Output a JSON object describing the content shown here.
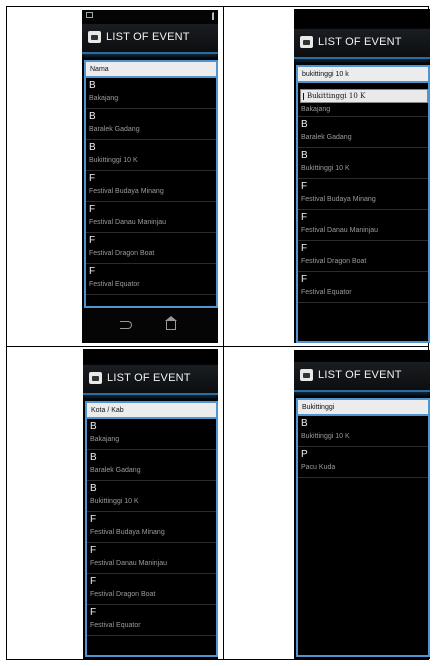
{
  "title": "LIST OF EVENT",
  "panels": {
    "p1": {
      "search": "Nama",
      "items": [
        {
          "letter": "B",
          "name": "Bakajang"
        },
        {
          "letter": "B",
          "name": "Baralek Gadang"
        },
        {
          "letter": "B",
          "name": "Bukittinggi 10 K"
        },
        {
          "letter": "F",
          "name": "Festival Budaya Minang"
        },
        {
          "letter": "F",
          "name": "Festival Danau Maninjau"
        },
        {
          "letter": "F",
          "name": "Festival Dragon Boat"
        },
        {
          "letter": "F",
          "name": "Festival Equator"
        }
      ]
    },
    "p2": {
      "search": "bukittinggi 10 k",
      "suggestion": "Bukittinggi 10 K",
      "first_name_partial": "Bakajang",
      "items": [
        {
          "letter": "B",
          "name": "Baralek Gadang"
        },
        {
          "letter": "B",
          "name": "Bukittinggi 10 K"
        },
        {
          "letter": "F",
          "name": "Festival Budaya Minang"
        },
        {
          "letter": "F",
          "name": "Festival Danau Maninjau"
        },
        {
          "letter": "F",
          "name": "Festival Dragon Boat"
        },
        {
          "letter": "F",
          "name": "Festival Equator"
        }
      ]
    },
    "p3": {
      "search": "Kota / Kab",
      "items": [
        {
          "letter": "B",
          "name": "Bakajang"
        },
        {
          "letter": "B",
          "name": "Baralek Gadang"
        },
        {
          "letter": "B",
          "name": "Bukittinggi 10 K"
        },
        {
          "letter": "F",
          "name": "Festival Budaya Minang"
        },
        {
          "letter": "F",
          "name": "Festival Danau Maninjau"
        },
        {
          "letter": "F",
          "name": "Festival Dragon Boat"
        },
        {
          "letter": "F",
          "name": "Festival Equator"
        }
      ]
    },
    "p4": {
      "search": "Bukittinggi",
      "items": [
        {
          "letter": "B",
          "name": "Bukittinggi 10 K"
        },
        {
          "letter": "P",
          "name": "Pacu Kuda"
        }
      ]
    }
  },
  "icons": {
    "app": "app-icon",
    "back": "back-icon",
    "home": "home-icon",
    "status": "notification-icon",
    "signal": "signal-icon"
  },
  "colors": {
    "accent": "#4f95d1",
    "background": "#000000",
    "item_title": "#f0f0f0",
    "item_subtitle": "#9b9b9b"
  }
}
